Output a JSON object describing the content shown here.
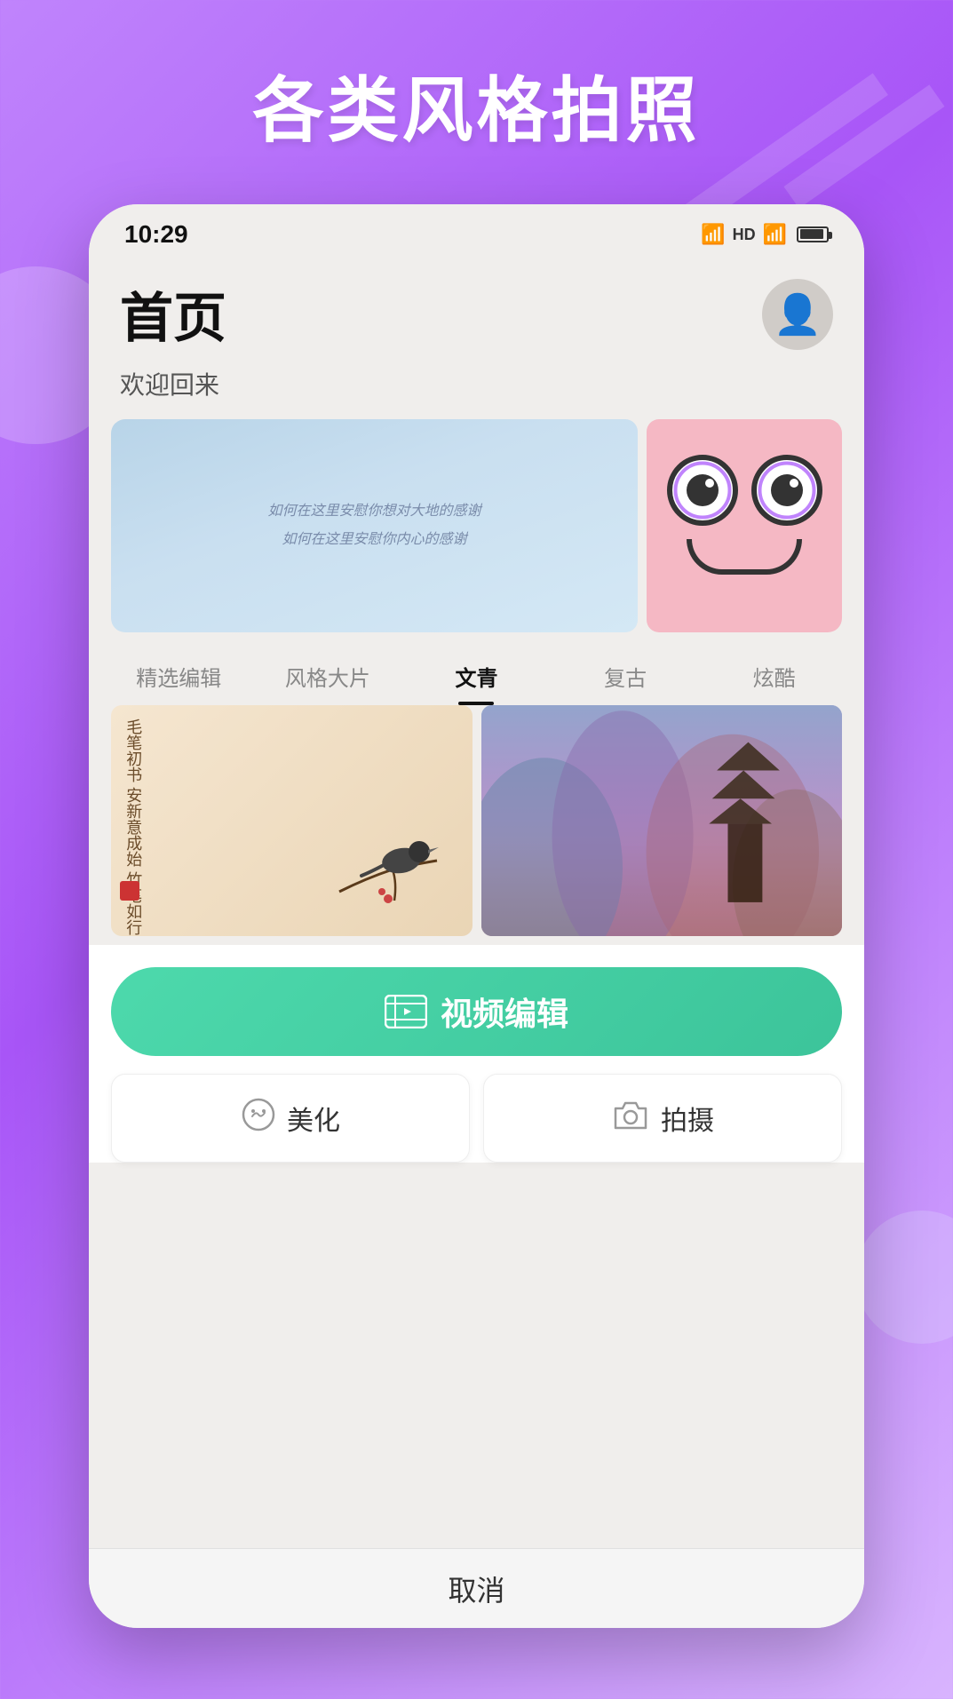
{
  "background": {
    "color_start": "#c084fc",
    "color_end": "#a855f7"
  },
  "page_title": "各类风格拍照",
  "phone": {
    "status_bar": {
      "time": "10:29",
      "icons": [
        "wifi",
        "hd",
        "signal",
        "battery"
      ]
    },
    "header": {
      "title": "首页",
      "welcome": "欢迎回来"
    },
    "banner_left_text": "如何在这里安慰你想对大地的感谢\n如何在这里安慰你内心的感谢",
    "tabs": [
      {
        "label": "精选编辑",
        "active": false
      },
      {
        "label": "风格大片",
        "active": false
      },
      {
        "label": "文青",
        "active": true
      },
      {
        "label": "复古",
        "active": false
      },
      {
        "label": "炫酷",
        "active": false
      }
    ],
    "ink_text": "毛笔初书\n安新意成始\n竹笔如行",
    "actions": {
      "video_edit_label": "视频编辑",
      "beautify_label": "美化",
      "camera_label": "拍摄"
    },
    "cancel_label": "取消"
  }
}
